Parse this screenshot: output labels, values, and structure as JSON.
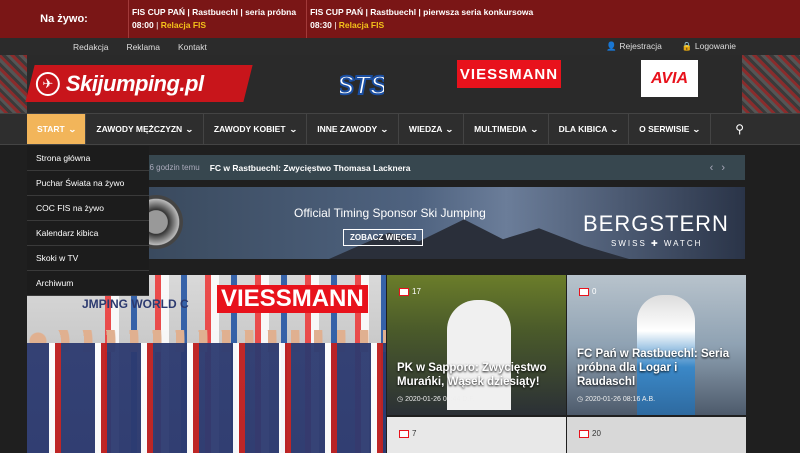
{
  "live": {
    "label": "Na żywo:",
    "items": [
      {
        "title": "FIS CUP PAŃ | Rastbuechl | seria próbna",
        "time": "08:00",
        "relation": "Relacja FIS"
      },
      {
        "title": "FIS CUP PAŃ | Rastbuechl | pierwsza seria konkursowa",
        "time": "08:30",
        "relation": "Relacja FIS"
      }
    ]
  },
  "topnav": {
    "links": [
      "Redakcja",
      "Reklama",
      "Kontakt"
    ],
    "register": "Rejestracja",
    "login": "Logowanie"
  },
  "header": {
    "logo_text": "Skijumping.pl",
    "sponsors": [
      "STS",
      "VIESSMANN",
      "AVIA"
    ]
  },
  "mainnav": {
    "items": [
      "START",
      "ZAWODY MĘŻCZYZN",
      "ZAWODY KOBIET",
      "INNE ZAWODY",
      "WIEDZA",
      "MULTIMEDIA",
      "DLA KIBICA",
      "O SERWISIE"
    ]
  },
  "dropdown": {
    "items": [
      "Strona główna",
      "Puchar Świata na żywo",
      "COC FIS na żywo",
      "Kalendarz kibica",
      "Skoki w TV",
      "Archiwum"
    ]
  },
  "ticker": {
    "ago": "16 godzin temu",
    "title": "FC w Rastbuechl: Zwycięstwo Thomasa Lacknera"
  },
  "banner": {
    "text": "Official Timing Sponsor Ski Jumping",
    "button": "ZOBACZ WIĘCEJ",
    "brand": "BERGSTERN",
    "brand_sub": "SWISS ✚ WATCH"
  },
  "cards": {
    "mid": {
      "comments": "17",
      "title": "PK w Sapporo: Zwycięstwo Murańki, Wąsek dziesiąty!",
      "meta": "2020-01-26 03:44 D.F."
    },
    "right": {
      "comments": "0",
      "title": "FC Pań w Rastbuechl: Seria próbna dla Logar i Raudaschl",
      "meta": "2020-01-26 08:16 A.B."
    },
    "mid2": {
      "comments": "7"
    },
    "right2": {
      "comments": "20"
    },
    "big": {
      "overlay_text": "VIESSMANN",
      "corner_text": "JMPING WORLD C"
    }
  },
  "colors": {
    "live_bg": "#7a1616",
    "active_nav": "#f2b55a",
    "brand_red": "#c8151b"
  }
}
